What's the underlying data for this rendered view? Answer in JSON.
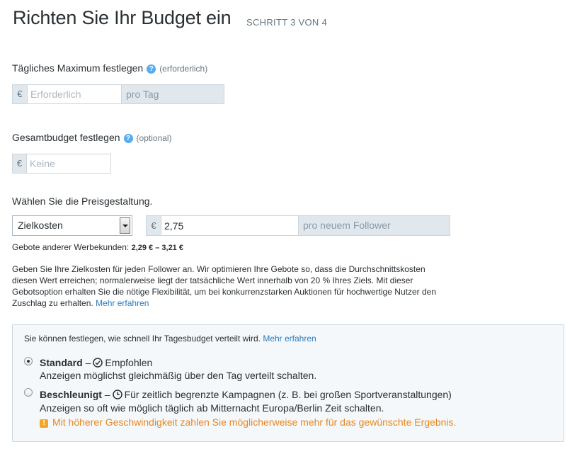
{
  "header": {
    "title": "Richten Sie Ihr Budget ein",
    "step": "SCHRITT 3 VON 4"
  },
  "daily_max": {
    "label": "Tägliches Maximum festlegen",
    "hint": "(erforderlich)",
    "currency": "€",
    "placeholder": "Erforderlich",
    "suffix": "pro Tag"
  },
  "total_budget": {
    "label": "Gesamtbudget festlegen",
    "hint": "(optional)",
    "currency": "€",
    "placeholder": "Keine"
  },
  "pricing": {
    "label": "Wählen Sie die Preisgestaltung.",
    "select_value": "Zielkosten",
    "currency": "€",
    "bid_value": "2,75",
    "suffix": "pro neuem Follower",
    "other_bids_label": "Gebote anderer Werbekunden:",
    "other_bids_range": "2,29 € – 3,21 €",
    "description": "Geben Sie Ihre Zielkosten für jeden Follower an. Wir optimieren Ihre Gebote so, dass die Durchschnittskosten diesen Wert erreichen; normalerweise liegt der tatsächliche Wert innerhalb von 20 % Ihres Ziels. Mit dieser Gebotsoption erhalten Sie die nötige Flexibilität, um bei konkurrenzstarken Auktionen für hochwertige Nutzer den Zuschlag zu erhalten.",
    "learn_more": "Mehr erfahren"
  },
  "pacing": {
    "intro": "Sie können festlegen, wie schnell Ihr Tagesbudget verteilt wird.",
    "learn_more": "Mehr erfahren",
    "standard": {
      "title": "Standard",
      "dash": "–",
      "tag": "Empfohlen",
      "description": "Anzeigen möglichst gleichmäßig über den Tag verteilt schalten.",
      "selected": true
    },
    "accelerated": {
      "title": "Beschleunigt",
      "dash": "–",
      "tag": "Für zeitlich begrenzte Kampagnen (z. B. bei großen Sportveranstaltungen)",
      "description": "Anzeigen so oft wie möglich täglich ab Mitternacht Europa/Berlin Zeit schalten.",
      "warning_icon": "!",
      "warning": "Mit höherer Geschwindigkeit zahlen Sie möglicherweise mehr für das gewünschte Ergebnis.",
      "selected": false
    }
  },
  "colors": {
    "link": "#2b7bb9",
    "help": "#55acee",
    "warning": "#e8861e"
  }
}
